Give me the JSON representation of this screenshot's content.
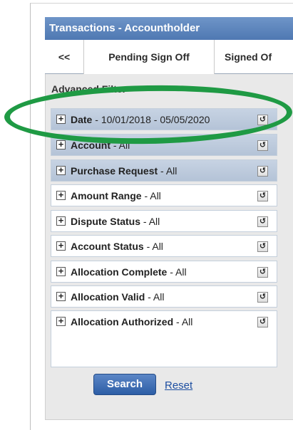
{
  "panel": {
    "title": "Transactions - Accountholder",
    "tabs": [
      {
        "label": "<<"
      },
      {
        "label": "Pending Sign Off"
      },
      {
        "label": "Signed Of"
      }
    ],
    "advanced_filter_label": "Advanced Filter"
  },
  "filters": [
    {
      "name": "Date",
      "value": "10/01/2018 - 05/05/2020"
    },
    {
      "name": "Account",
      "value": "All"
    },
    {
      "name": "Purchase Request",
      "value": "All"
    },
    {
      "name": "Amount Range",
      "value": "All"
    },
    {
      "name": "Dispute Status",
      "value": "All"
    },
    {
      "name": "Account Status",
      "value": "All"
    },
    {
      "name": "Allocation Complete",
      "value": "All"
    },
    {
      "name": "Allocation Valid",
      "value": "All"
    },
    {
      "name": "Allocation Authorized",
      "value": "All"
    }
  ],
  "actions": {
    "search_label": "Search",
    "reset_label": "Reset"
  },
  "icons": {
    "expand": "plus-box-icon",
    "reset": "reset-icon"
  },
  "colors": {
    "header": "#4f78b2",
    "highlight": "#1f9a44",
    "link": "#1e4fa1"
  }
}
